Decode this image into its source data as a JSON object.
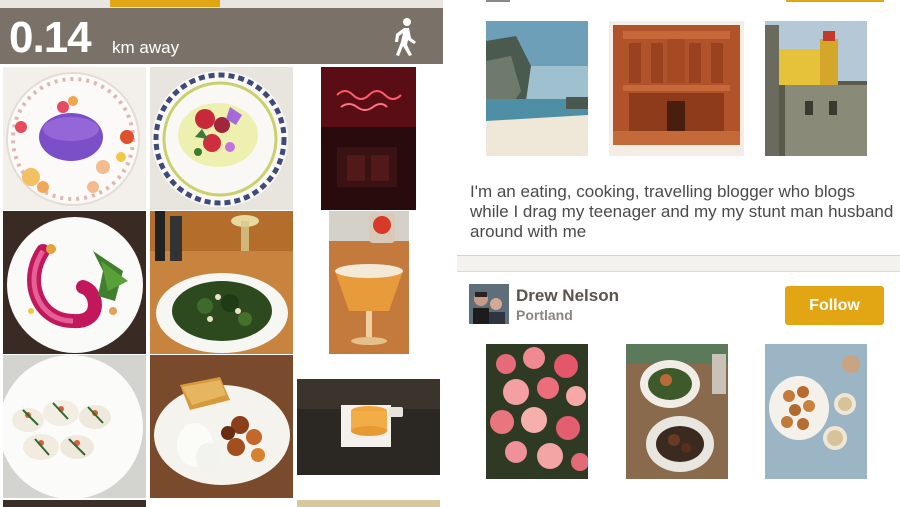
{
  "left_panel": {
    "distance_value": "0.14",
    "distance_unit": "km away",
    "walk_icon": "walking-person-icon",
    "grid_photos": [
      "purple-dessert-plate-photo",
      "beet-salad-flowers-photo",
      "red-neon-sign-bar-photo",
      "beet-puree-plate-photo",
      "kale-salad-wine-photo",
      "cocktail-glass-photo",
      "ravioli-plate-photo",
      "burrata-potatoes-plate-photo",
      "macaron-dessert-photo"
    ]
  },
  "right_panel": {
    "top_photos": [
      "coastal-beach-cliff-photo",
      "petra-monument-photo",
      "yellow-palace-photo"
    ],
    "bio": "I'm an eating, cooking, travelling blogger who blogs while I drag my teenager and my my stunt man husband around with me",
    "user": {
      "name": "Drew Nelson",
      "city": "Portland",
      "follow_label": "Follow"
    },
    "user_photos": [
      "pink-roses-photo",
      "dinner-table-photo",
      "donuts-coffee-photo"
    ]
  },
  "colors": {
    "accent": "#e2a615",
    "header_bar": "#7a7268",
    "text": "#4a4a4a"
  }
}
